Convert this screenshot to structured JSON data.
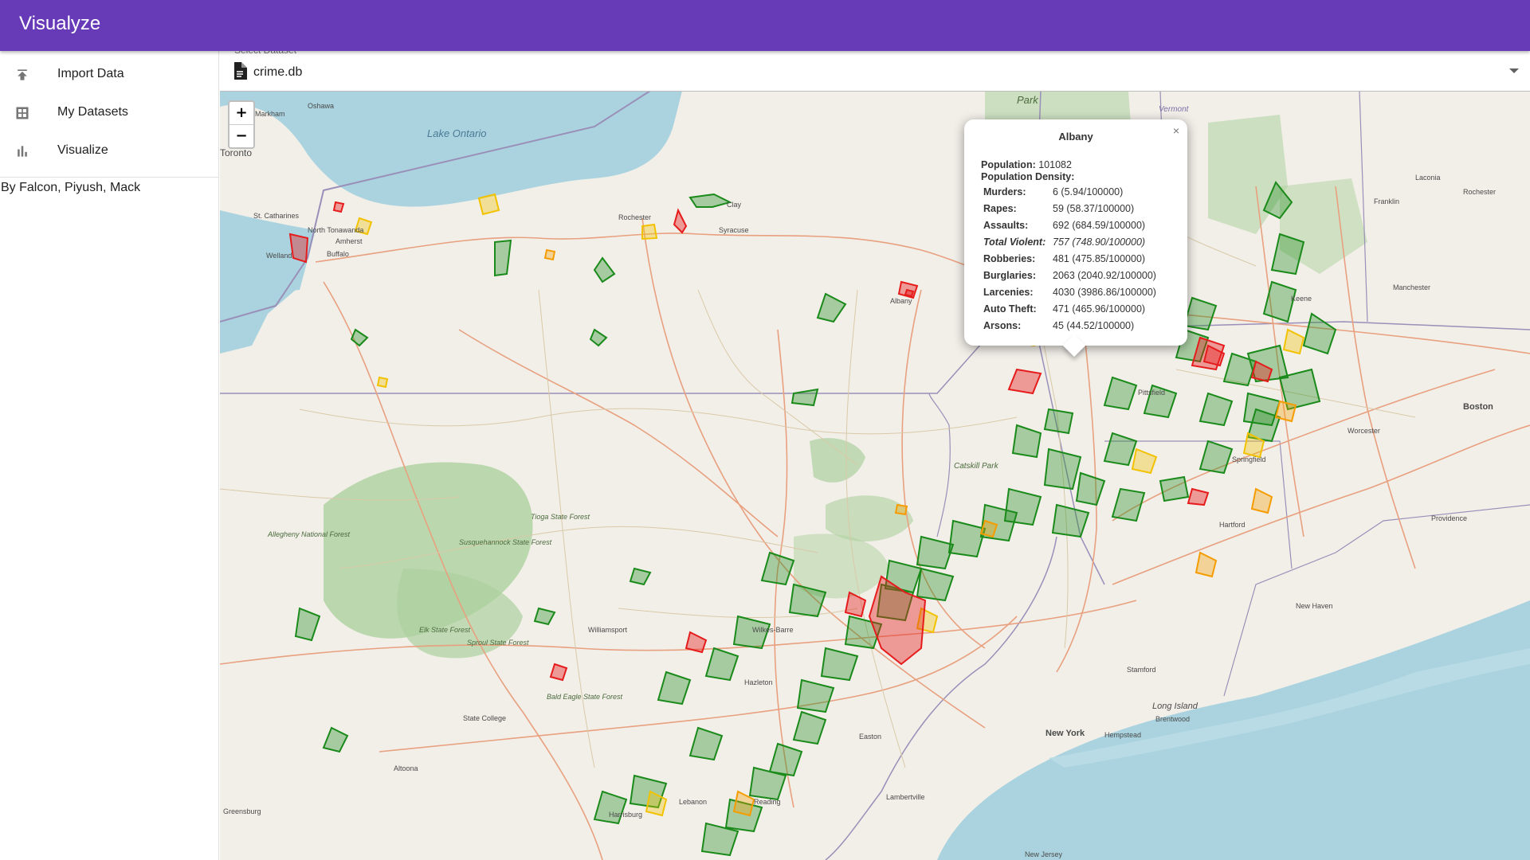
{
  "app": {
    "title": "Visualyze"
  },
  "sidebar": {
    "items": [
      {
        "label": "Import Data",
        "icon": "upload-icon"
      },
      {
        "label": "My Datasets",
        "icon": "grid-icon"
      },
      {
        "label": "Visualize",
        "icon": "bar-chart-icon"
      }
    ],
    "credits": "By Falcon, Piyush, Mack"
  },
  "dataset_select": {
    "legend": "Select Dataset",
    "value": "crime.db"
  },
  "map": {
    "zoom_in": "+",
    "zoom_out": "−",
    "labels": {
      "lake": "Lake Ontario",
      "toronto": "Toronto",
      "oshawa": "Oshawa",
      "markham": "Markham",
      "st_catharines": "St. Catharines",
      "welland": "Welland",
      "north_tonawanda": "North Tonawanda",
      "amherst": "Amherst",
      "buffalo": "Buffalo",
      "rochester": "Rochester",
      "clay": "Clay",
      "syracuse": "Syracuse",
      "albany": "Albany",
      "catskill": "Catskill Park",
      "tioga": "Tioga State Forest",
      "allegheny": "Allegheny National Forest",
      "susquehannock": "Susquehannock State Forest",
      "elk": "Elk State Forest",
      "sproul": "Sproul State Forest",
      "bald_eagle": "Bald Eagle State Forest",
      "state_college": "State College",
      "williamsport": "Williamsport",
      "wilkes_barre": "Wilkes-Barre",
      "hazleton": "Hazleton",
      "altoona": "Altoona",
      "greensburg": "Greensburg",
      "harrisburg": "Harrisburg",
      "lebanon": "Lebanon",
      "reading": "Reading",
      "lambertville": "Lambertville",
      "easton": "Easton",
      "new_york": "New York",
      "hempstead": "Hempstead",
      "long_island": "Long Island",
      "brentwood": "Brentwood",
      "stamford": "Stamford",
      "new_haven": "New Haven",
      "hartford": "Hartford",
      "springfield": "Springfield",
      "worcester": "Worcester",
      "boston": "Boston",
      "providence": "Providence",
      "new_jersey": "New Jersey",
      "pittsfield": "Pittsfield",
      "keene": "Keene",
      "manchester": "Manchester",
      "park": "Park",
      "vermont": "Vermont",
      "franklin": "Franklin",
      "rochester_nh": "Rochester",
      "laconia": "Laconia"
    }
  },
  "popup": {
    "title": "Albany",
    "population_label": "Population:",
    "population_value": "101082",
    "density_label": "Population Density:",
    "close": "×",
    "rows": [
      {
        "label": "Murders:",
        "value": "6 (5.94/100000)"
      },
      {
        "label": "Rapes:",
        "value": "59 (58.37/100000)"
      },
      {
        "label": "Assaults:",
        "value": "692 (684.59/100000)"
      },
      {
        "label": "Total Violent:",
        "value": "757 (748.90/100000)"
      },
      {
        "label": "Robberies:",
        "value": "481 (475.85/100000)"
      },
      {
        "label": "Burglaries:",
        "value": "2063 (2040.92/100000)"
      },
      {
        "label": "Larcenies:",
        "value": "4030 (3986.86/100000)"
      },
      {
        "label": "Auto Theft:",
        "value": "471 (465.96/100000)"
      },
      {
        "label": "Arsons:",
        "value": "45 (44.52/100000)"
      }
    ]
  },
  "colors": {
    "appbar": "#673ab7",
    "water": "#aad3df",
    "land": "#f2efe9",
    "forest": "#add19e",
    "region_low": "#1a8a1a",
    "region_mid": "#f2c200",
    "region_high": "#e61c1c",
    "region_orange": "#f59d00"
  }
}
